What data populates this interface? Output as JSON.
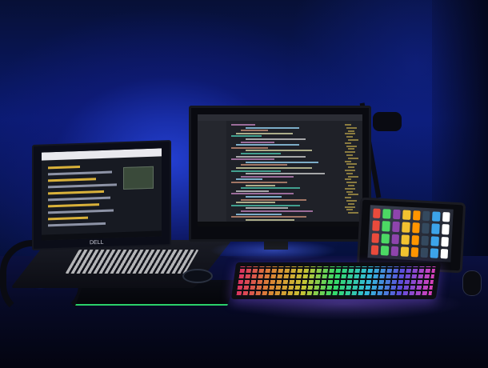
{
  "scene": {
    "description_colors": {
      "ambient": "#1e3ad8",
      "monitor_code_bg": "#1f2128",
      "keyboard_rgb": [
        "#ff3a6e",
        "#ff9a3a",
        "#e9e23a",
        "#3aff7a",
        "#3ad9ff",
        "#6a5aff",
        "#ff4ad8"
      ],
      "laptop_highlight": "#d9b13a",
      "cooling_pad_led": "#2ad06a"
    },
    "laptop": {
      "brand": "DELL"
    }
  },
  "icons": [
    "laptop-icon",
    "monitor-icon",
    "tablet-icon",
    "keyboard-icon",
    "mouse-icon",
    "microphone-icon",
    "headset-icon"
  ]
}
